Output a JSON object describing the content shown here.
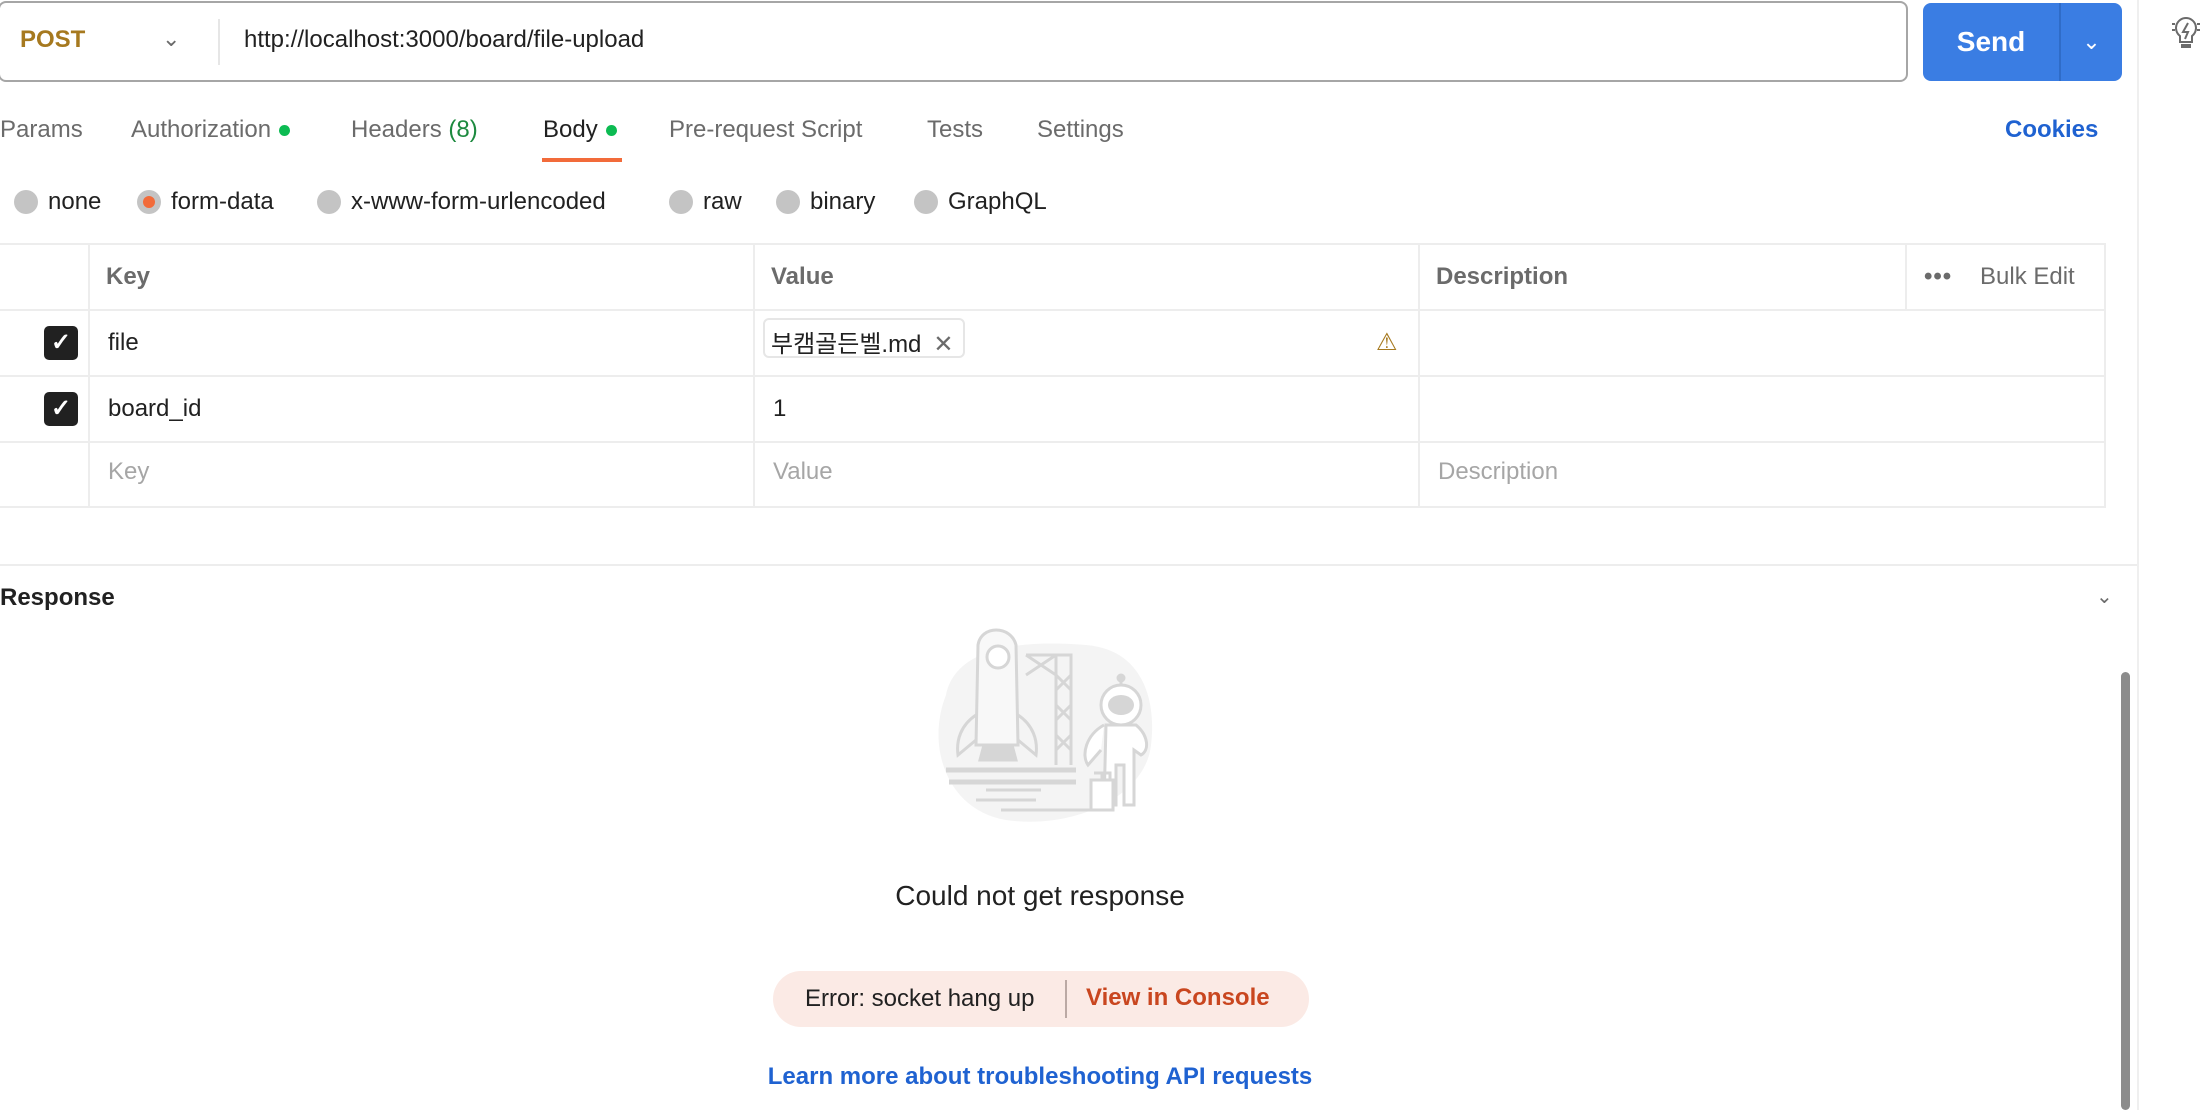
{
  "request": {
    "method": "POST",
    "url": "http://localhost:3000/board/file-upload",
    "send_label": "Send"
  },
  "tabs": [
    {
      "label": "Params"
    },
    {
      "label": "Authorization",
      "dot": true
    },
    {
      "label": "Headers",
      "count": "(8)"
    },
    {
      "label": "Body",
      "dot": true,
      "active": true
    },
    {
      "label": "Pre-request Script"
    },
    {
      "label": "Tests"
    },
    {
      "label": "Settings"
    }
  ],
  "cookies_label": "Cookies",
  "body_types": [
    {
      "label": "none"
    },
    {
      "label": "form-data",
      "selected": true
    },
    {
      "label": "x-www-form-urlencoded"
    },
    {
      "label": "raw"
    },
    {
      "label": "binary"
    },
    {
      "label": "GraphQL"
    }
  ],
  "table": {
    "headers": {
      "key": "Key",
      "value": "Value",
      "description": "Description",
      "bulk_edit": "Bulk Edit"
    },
    "rows": [
      {
        "checked": true,
        "key": "file",
        "value": "부캠골든벨.md",
        "type": "file",
        "warning": true
      },
      {
        "checked": true,
        "key": "board_id",
        "value": "1"
      }
    ],
    "placeholders": {
      "key": "Key",
      "value": "Value",
      "description": "Description"
    }
  },
  "response": {
    "title": "Response",
    "message": "Could not get response",
    "error": "Error: socket hang up",
    "console_link": "View in Console",
    "learn_more": "Learn more about troubleshooting API requests"
  },
  "colors": {
    "accent": "#f26b3a",
    "send": "#3a7de3",
    "link": "#1f62d1",
    "method": "#a6791f",
    "dot": "#0cbb52",
    "error_bg": "#fbeae5"
  }
}
